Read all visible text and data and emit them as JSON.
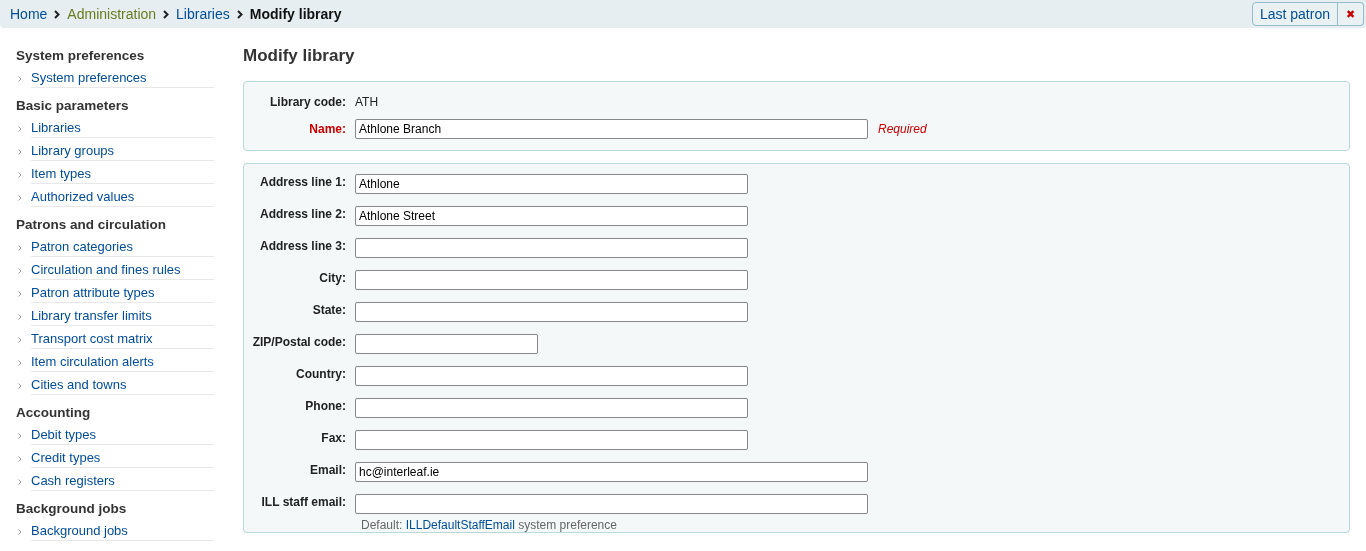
{
  "breadcrumb": [
    {
      "label": "Home",
      "kind": "link"
    },
    {
      "label": "Administration",
      "kind": "admin"
    },
    {
      "label": "Libraries",
      "kind": "link"
    },
    {
      "label": "Modify library",
      "kind": "current"
    }
  ],
  "header_buttons": {
    "last_patron": "Last patron",
    "close": "✖"
  },
  "sidebar": [
    {
      "heading": "System preferences",
      "items": [
        "System preferences"
      ]
    },
    {
      "heading": "Basic parameters",
      "items": [
        "Libraries",
        "Library groups",
        "Item types",
        "Authorized values"
      ]
    },
    {
      "heading": "Patrons and circulation",
      "items": [
        "Patron categories",
        "Circulation and fines rules",
        "Patron attribute types",
        "Library transfer limits",
        "Transport cost matrix",
        "Item circulation alerts",
        "Cities and towns"
      ]
    },
    {
      "heading": "Accounting",
      "items": [
        "Debit types",
        "Credit types",
        "Cash registers"
      ]
    },
    {
      "heading": "Background jobs",
      "items": [
        "Background jobs"
      ]
    }
  ],
  "page_title": "Modify library",
  "identity": {
    "code_label": "Library code:",
    "code": "ATH",
    "name_label": "Name:",
    "name": "Athlone Branch",
    "required": "Required"
  },
  "fields": [
    {
      "label": "Address line 1:",
      "value": "Athlone",
      "kind": "medium"
    },
    {
      "label": "Address line 2:",
      "value": "Athlone Street",
      "kind": "medium"
    },
    {
      "label": "Address line 3:",
      "kind": "medium"
    },
    {
      "label": "City:",
      "kind": "medium"
    },
    {
      "label": "State:",
      "kind": "medium"
    },
    {
      "label": "ZIP/Postal code:",
      "kind": "short"
    },
    {
      "label": "Country:",
      "kind": "medium"
    },
    {
      "label": "Phone:",
      "kind": "medium"
    },
    {
      "label": "Fax:",
      "kind": "medium"
    },
    {
      "label": "Email:",
      "value": "hc@interleaf.ie",
      "kind": "long"
    },
    {
      "label": "ILL staff email:",
      "kind": "long"
    }
  ],
  "ill_hint": {
    "prefix": "Default:",
    "link": "ILLDefaultStaffEmail",
    "suffix": "system preference"
  }
}
